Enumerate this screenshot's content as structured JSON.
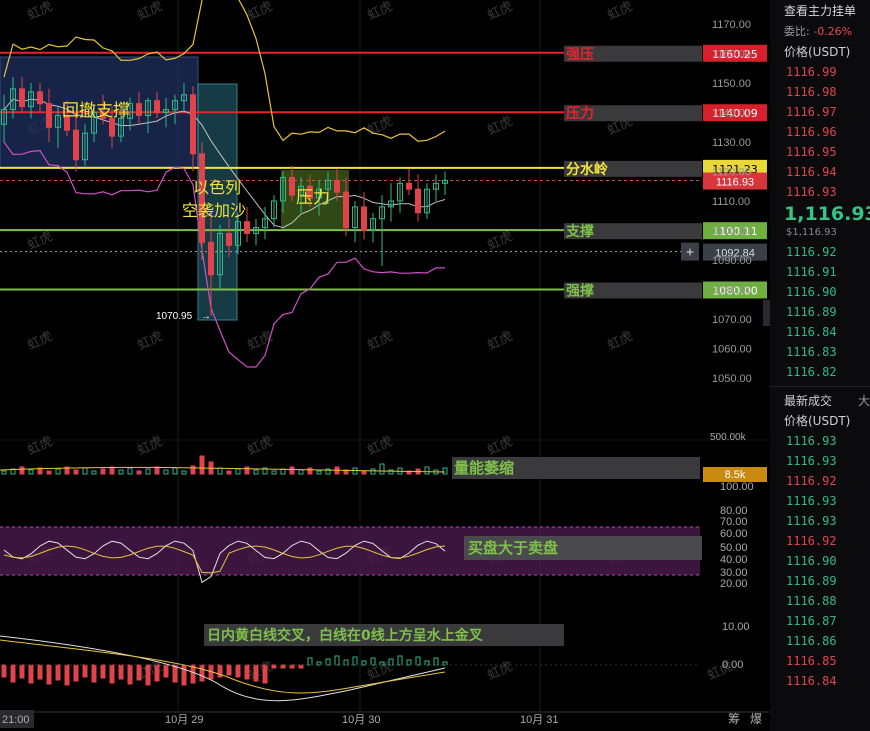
{
  "chart_data": {
    "type": "candlestick",
    "instrument_unit": "USDT",
    "price_axis": {
      "ylim": [
        1042,
        1178
      ],
      "ticks": [
        "1170.00",
        "1160.00",
        "1150.00",
        "1140.00",
        "1130.00",
        "1120.00",
        "1110.00",
        "1100.00",
        "1090.00",
        "1080.00",
        "1070.00",
        "1060.00",
        "1050.00"
      ]
    },
    "time_axis": {
      "labels": [
        "21:00",
        "10月 29",
        "10月 30",
        "10月 31"
      ]
    },
    "levels": [
      {
        "name": "强压",
        "value": 1160.25,
        "label": "1160.25",
        "color": "#e8232b"
      },
      {
        "name": "压力",
        "value": 1140.09,
        "label": "1140.09",
        "color": "#e8232b"
      },
      {
        "name": "分水岭",
        "value": 1121.23,
        "label": "1121.23",
        "color": "#f2e33a"
      },
      {
        "name": "支撑",
        "value": 1100.11,
        "label": "1100.11",
        "color": "#7ec04a"
      },
      {
        "name": "强撑",
        "value": 1080.0,
        "label": "1080.00",
        "color": "#7ec04a"
      }
    ],
    "last_price": {
      "value": 1116.93,
      "label": "1116.93"
    },
    "crosshair_price": {
      "value": 1092.84,
      "label": "1092.84"
    },
    "low_marker": {
      "value": 1070.95,
      "label": "1070.95"
    },
    "annotations": {
      "retrace_support": "回撤支撑",
      "israel_attack": [
        "以色列",
        "空袭加沙"
      ],
      "pressure_box": "压力",
      "volume_shrink": "量能萎缩",
      "buy_over_sell": "买盘大于卖盘",
      "macd_note": "日内黄白线交叉，白线在0线上方呈水上金叉"
    },
    "volume": {
      "ticks": [
        "500.00k"
      ],
      "last_label": "8.5k"
    },
    "rsi": {
      "ticks": [
        "100.00",
        "80.00",
        "70.00",
        "60.00",
        "50.00",
        "40.00",
        "30.00",
        "20.00"
      ]
    },
    "macd": {
      "ticks": [
        "10.00",
        "0.00"
      ]
    },
    "candles": [
      [
        1136,
        1146,
        1130,
        1141
      ],
      [
        1141,
        1152,
        1138,
        1148
      ],
      [
        1148,
        1152,
        1140,
        1142
      ],
      [
        1142,
        1150,
        1138,
        1147
      ],
      [
        1147,
        1150,
        1140,
        1143
      ],
      [
        1143,
        1148,
        1130,
        1135
      ],
      [
        1135,
        1142,
        1128,
        1139
      ],
      [
        1139,
        1144,
        1132,
        1134
      ],
      [
        1134,
        1140,
        1120,
        1124
      ],
      [
        1124,
        1136,
        1122,
        1133
      ],
      [
        1133,
        1142,
        1130,
        1140
      ],
      [
        1140,
        1146,
        1136,
        1138
      ],
      [
        1138,
        1142,
        1128,
        1132
      ],
      [
        1132,
        1140,
        1130,
        1138
      ],
      [
        1138,
        1145,
        1134,
        1143
      ],
      [
        1143,
        1147,
        1136,
        1139
      ],
      [
        1139,
        1145,
        1133,
        1144
      ],
      [
        1144,
        1147,
        1138,
        1140
      ],
      [
        1140,
        1145,
        1135,
        1141
      ],
      [
        1141,
        1146,
        1136,
        1144
      ],
      [
        1144,
        1150,
        1140,
        1146
      ],
      [
        1146,
        1149,
        1120,
        1126
      ],
      [
        1126,
        1130,
        1090,
        1096
      ],
      [
        1096,
        1106,
        1071,
        1085
      ],
      [
        1085,
        1102,
        1080,
        1099
      ],
      [
        1099,
        1104,
        1091,
        1095
      ],
      [
        1095,
        1106,
        1092,
        1103
      ],
      [
        1103,
        1108,
        1096,
        1099
      ],
      [
        1099,
        1104,
        1095,
        1101
      ],
      [
        1101,
        1108,
        1097,
        1104
      ],
      [
        1104,
        1112,
        1101,
        1110
      ],
      [
        1110,
        1120,
        1106,
        1118
      ],
      [
        1118,
        1122,
        1110,
        1112
      ],
      [
        1112,
        1118,
        1106,
        1115
      ],
      [
        1115,
        1119,
        1108,
        1111
      ],
      [
        1111,
        1117,
        1105,
        1114
      ],
      [
        1114,
        1120,
        1109,
        1117
      ],
      [
        1117,
        1121,
        1110,
        1113
      ],
      [
        1113,
        1118,
        1098,
        1101
      ],
      [
        1101,
        1110,
        1096,
        1108
      ],
      [
        1108,
        1113,
        1097,
        1100
      ],
      [
        1100,
        1106,
        1096,
        1104
      ],
      [
        1104,
        1112,
        1088,
        1108
      ],
      [
        1108,
        1116,
        1103,
        1110
      ],
      [
        1110,
        1118,
        1106,
        1116
      ],
      [
        1116,
        1121,
        1112,
        1114
      ],
      [
        1114,
        1119,
        1103,
        1106
      ],
      [
        1106,
        1116,
        1104,
        1114
      ],
      [
        1114,
        1119,
        1110,
        1116
      ],
      [
        1116,
        1120,
        1112,
        1117
      ]
    ]
  },
  "sidebar": {
    "header": "查看主力挂单",
    "ratio_label": "委比:",
    "ratio_value": "-0.26%",
    "price_label": "价格(USDT)",
    "asks": [
      "1116.99",
      "1116.98",
      "1116.97",
      "1116.96",
      "1116.95",
      "1116.94",
      "1116.93"
    ],
    "last_price": "1,116.93",
    "last_price_sub": "$1,116.93",
    "bids": [
      "1116.92",
      "1116.91",
      "1116.90",
      "1116.89",
      "1116.84",
      "1116.83",
      "1116.82"
    ],
    "trades_label": "最新成交",
    "trades_size_label": "大",
    "trades_price_label": "价格(USDT)",
    "trades": [
      {
        "p": "1116.93",
        "c": "green"
      },
      {
        "p": "1116.93",
        "c": "green"
      },
      {
        "p": "1116.92",
        "c": "red"
      },
      {
        "p": "1116.93",
        "c": "green"
      },
      {
        "p": "1116.93",
        "c": "green"
      },
      {
        "p": "1116.92",
        "c": "red"
      },
      {
        "p": "1116.90",
        "c": "green"
      },
      {
        "p": "1116.89",
        "c": "green"
      },
      {
        "p": "1116.88",
        "c": "green"
      },
      {
        "p": "1116.87",
        "c": "green"
      },
      {
        "p": "1116.86",
        "c": "green"
      },
      {
        "p": "1116.85",
        "c": "red"
      },
      {
        "p": "1116.84",
        "c": "red"
      }
    ]
  },
  "footer": {
    "left": "筹",
    "right": "爆"
  },
  "watermark": "虹虎",
  "colors": {
    "up": "#2fb88a",
    "down": "#e0444a",
    "band": "#e8c33a",
    "bbmid": "#c0c0c0",
    "bblow": "#d050c8"
  }
}
